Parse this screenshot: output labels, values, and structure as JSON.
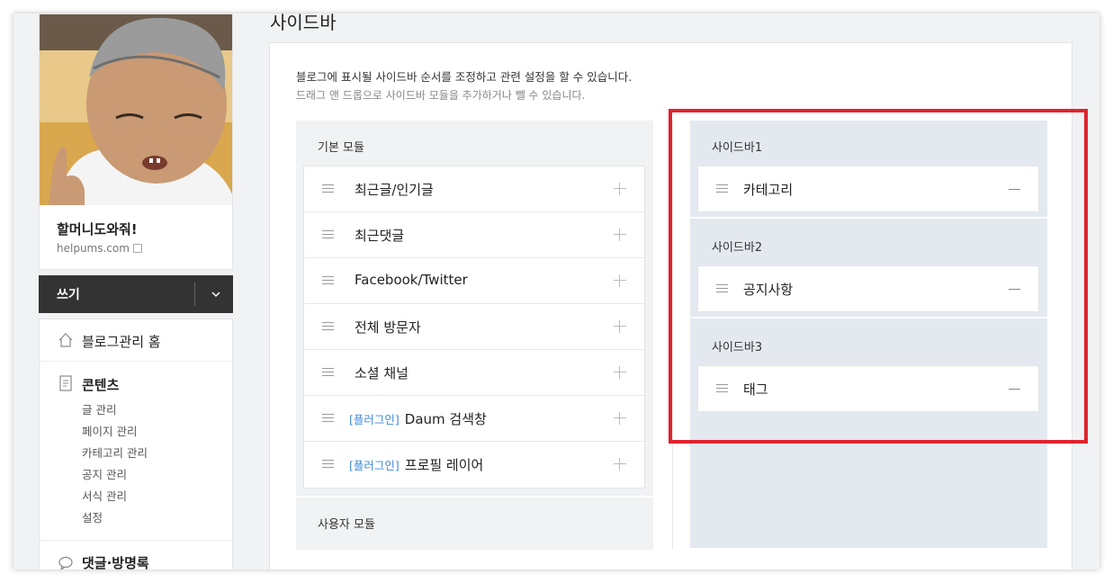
{
  "profile": {
    "blog_name": "할머니도와줘!",
    "blog_url": "helpums.com"
  },
  "write_button": {
    "label": "쓰기"
  },
  "nav": {
    "home": "블로그관리 홈",
    "contents": {
      "title": "콘텐츠",
      "items": [
        "글 관리",
        "페이지 관리",
        "카테고리 관리",
        "공지 관리",
        "서식 관리",
        "설정"
      ]
    },
    "comments": "댓글·방명록"
  },
  "page": {
    "title": "사이드바",
    "desc1": "블로그에 표시될 사이드바 순서를 조정하고 관련 설정을 할 수 있습니다.",
    "desc2": "드래그 앤 드롭으로 사이드바 모듈을 추가하거나 뺄 수 있습니다."
  },
  "basic_modules": {
    "title": "기본 모듈",
    "items": [
      {
        "tag": "",
        "label": "최근글/인기글"
      },
      {
        "tag": "",
        "label": "최근댓글"
      },
      {
        "tag": "",
        "label": "Facebook/Twitter"
      },
      {
        "tag": "",
        "label": "전체 방문자"
      },
      {
        "tag": "",
        "label": "소셜 채널"
      },
      {
        "tag": "[플러그인]",
        "label": "Daum 검색창"
      },
      {
        "tag": "[플러그인]",
        "label": "프로필 레이어"
      }
    ]
  },
  "user_modules": {
    "title": "사용자 모듈"
  },
  "sidebars": [
    {
      "title": "사이드바1",
      "item": "카테고리"
    },
    {
      "title": "사이드바2",
      "item": "공지사항"
    },
    {
      "title": "사이드바3",
      "item": "태그"
    }
  ],
  "colors": {
    "highlight": "#e0242e",
    "plugin_tag": "#3d88d8",
    "write_button": "#333333"
  }
}
